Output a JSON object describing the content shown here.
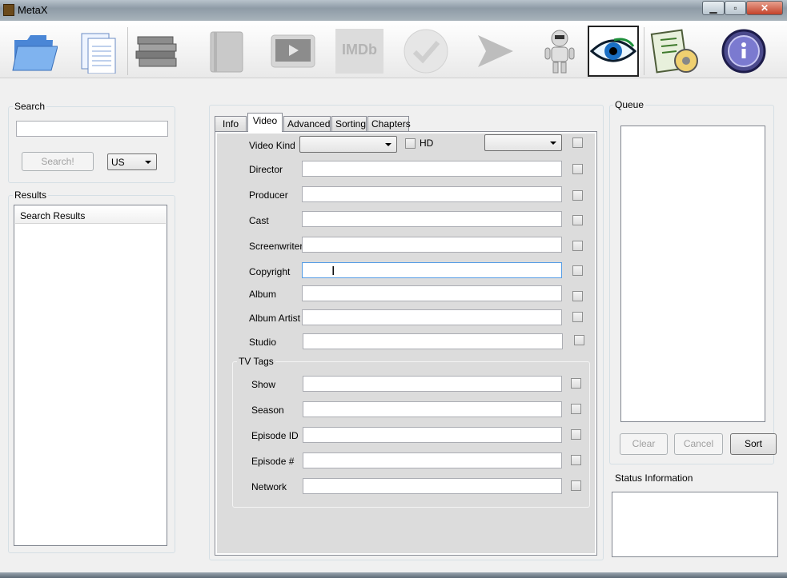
{
  "window": {
    "title": "MetaX",
    "minimize": "▁",
    "maximize": "▫",
    "close": "✕"
  },
  "toolbar": {
    "items": [
      {
        "name": "open-folder-icon",
        "glyph": "📁"
      },
      {
        "name": "document-icon",
        "glyph": "📄"
      },
      {
        "name": "batch-books-icon",
        "glyph": "📚"
      },
      {
        "name": "book-icon",
        "glyph": "📕"
      },
      {
        "name": "video-player-icon",
        "glyph": "▶"
      },
      {
        "name": "imdb-icon",
        "glyph": "IMDb"
      },
      {
        "name": "checkmark-icon",
        "glyph": "✔"
      },
      {
        "name": "arrow-right-icon",
        "glyph": "➤"
      },
      {
        "name": "robot-icon",
        "glyph": "🤖"
      },
      {
        "name": "eye-icon",
        "glyph": "👁"
      },
      {
        "name": "settings-checklist-icon",
        "glyph": "📋"
      },
      {
        "name": "about-icon",
        "glyph": "ℹ"
      }
    ]
  },
  "search": {
    "group_label": "Search",
    "query": "",
    "button": "Search!",
    "region": "US"
  },
  "results": {
    "group_label": "Results",
    "header": "Search Results"
  },
  "tabs": [
    "Info",
    "Video",
    "Advanced",
    "Sorting",
    "Chapters"
  ],
  "video": {
    "video_kind_label": "Video Kind",
    "video_kind_value": "",
    "hd_label": "HD",
    "hd_dropdown_value": "",
    "fields": [
      {
        "label": "Director",
        "value": ""
      },
      {
        "label": "Producer",
        "value": ""
      },
      {
        "label": "Cast",
        "value": ""
      },
      {
        "label": "Screenwriter",
        "value": ""
      },
      {
        "label": "Copyright",
        "value": ""
      },
      {
        "label": "Album",
        "value": ""
      },
      {
        "label": "Album Artist",
        "value": ""
      },
      {
        "label": "Studio",
        "value": ""
      }
    ],
    "tv_group_label": "TV Tags",
    "tv_fields": [
      {
        "label": "Show",
        "value": ""
      },
      {
        "label": "Season",
        "value": ""
      },
      {
        "label": "Episode ID",
        "value": ""
      },
      {
        "label": "Episode #",
        "value": ""
      },
      {
        "label": "Network",
        "value": ""
      }
    ]
  },
  "queue": {
    "group_label": "Queue",
    "clear": "Clear",
    "cancel": "Cancel",
    "sort": "Sort"
  },
  "status": {
    "group_label": "Status Information",
    "text": ""
  }
}
